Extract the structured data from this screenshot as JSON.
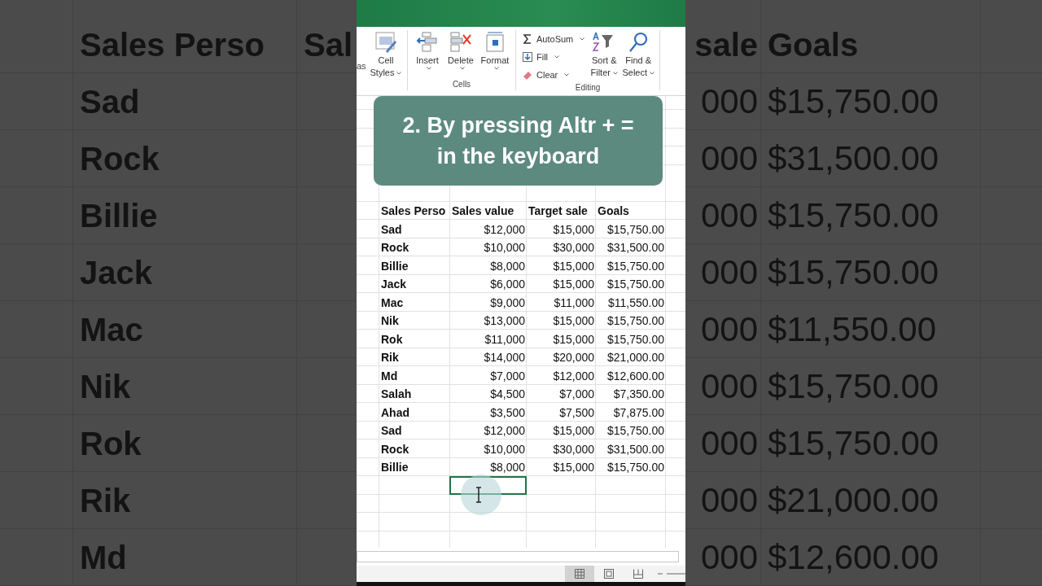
{
  "backdrop_left": {
    "headers": [
      "Sales Perso",
      "Sal"
    ],
    "names": [
      "Sad",
      "Rock",
      "Billie",
      "Jack",
      "Mac",
      "Nik",
      "Rok",
      "Rik",
      "Md"
    ]
  },
  "backdrop_right": {
    "headers": [
      "sale",
      "Goals"
    ],
    "rows": [
      {
        "target": "000",
        "goal": "$15,750.00"
      },
      {
        "target": "000",
        "goal": "$31,500.00"
      },
      {
        "target": "000",
        "goal": "$15,750.00"
      },
      {
        "target": "000",
        "goal": "$15,750.00"
      },
      {
        "target": "000",
        "goal": "$11,550.00"
      },
      {
        "target": "000",
        "goal": "$15,750.00"
      },
      {
        "target": "000",
        "goal": "$15,750.00"
      },
      {
        "target": "000",
        "goal": "$21,000.00"
      },
      {
        "target": "000",
        "goal": "$12,600.00"
      }
    ]
  },
  "ribbon": {
    "partial_label": "as",
    "groups": [
      {
        "items": [
          {
            "kind": "cell-styles",
            "lines": [
              "Cell",
              "Styles"
            ],
            "dropdown": true
          }
        ]
      },
      {
        "label": "Cells",
        "items": [
          {
            "kind": "insert",
            "lines": [
              "Insert"
            ],
            "dropdown": true
          },
          {
            "kind": "delete",
            "lines": [
              "Delete"
            ],
            "dropdown": true
          },
          {
            "kind": "format",
            "lines": [
              "Format"
            ],
            "dropdown": true
          }
        ]
      },
      {
        "label": "Editing",
        "items": [
          {
            "kind": "autosum",
            "lines": [
              "AutoSum"
            ],
            "dropdown": true
          },
          {
            "kind": "fill",
            "lines": [
              "Fill"
            ],
            "dropdown": true
          },
          {
            "kind": "clear",
            "lines": [
              "Clear"
            ],
            "dropdown": true
          },
          {
            "kind": "sort-filter",
            "lines": [
              "Sort &",
              "Filter"
            ],
            "dropdown": true
          },
          {
            "kind": "find-select",
            "lines": [
              "Find &",
              "Select"
            ],
            "dropdown": true
          }
        ]
      }
    ]
  },
  "caption": {
    "lines": [
      "2. By pressing Altr + =",
      "in the keyboard"
    ]
  },
  "sheet": {
    "rows": [
      {
        "header": true,
        "cells": [
          "Sales Perso",
          "Sales value",
          "Target sale",
          "Goals"
        ]
      },
      {
        "header": false,
        "cells": [
          "Sad",
          "$12,000",
          "$15,000",
          "$15,750.00"
        ]
      },
      {
        "header": false,
        "cells": [
          "Rock",
          "$10,000",
          "$30,000",
          "$31,500.00"
        ]
      },
      {
        "header": false,
        "cells": [
          "Billie",
          "$8,000",
          "$15,000",
          "$15,750.00"
        ]
      },
      {
        "header": false,
        "cells": [
          "Jack",
          "$6,000",
          "$15,000",
          "$15,750.00"
        ]
      },
      {
        "header": false,
        "cells": [
          "Mac",
          "$9,000",
          "$11,000",
          "$11,550.00"
        ]
      },
      {
        "header": false,
        "cells": [
          "Nik",
          "$13,000",
          "$15,000",
          "$15,750.00"
        ]
      },
      {
        "header": false,
        "cells": [
          "Rok",
          "$11,000",
          "$15,000",
          "$15,750.00"
        ]
      },
      {
        "header": false,
        "cells": [
          "Rik",
          "$14,000",
          "$20,000",
          "$21,000.00"
        ]
      },
      {
        "header": false,
        "cells": [
          "Md",
          "$7,000",
          "$12,000",
          "$12,600.00"
        ]
      },
      {
        "header": false,
        "cells": [
          "Salah",
          "$4,500",
          "$7,000",
          "$7,350.00"
        ]
      },
      {
        "header": false,
        "cells": [
          "Ahad",
          "$3,500",
          "$7,500",
          "$7,875.00"
        ]
      },
      {
        "header": false,
        "cells": [
          "Sad",
          "$12,000",
          "$15,000",
          "$15,750.00"
        ]
      },
      {
        "header": false,
        "cells": [
          "Rock",
          "$10,000",
          "$30,000",
          "$31,500.00"
        ]
      },
      {
        "header": false,
        "cells": [
          "Billie",
          "$8,000",
          "$15,000",
          "$15,750.00"
        ]
      }
    ],
    "blank_rows": [
      {
        "selected_cells": [
          false,
          true,
          false,
          false
        ]
      },
      {
        "selected_cells": [
          false,
          false,
          false,
          false
        ]
      },
      {
        "selected_cells": [
          false,
          false,
          false,
          false
        ]
      },
      {
        "selected_cells": [
          false,
          false,
          false,
          false
        ]
      }
    ]
  },
  "status_bar": {
    "views": [
      {
        "kind": "normal",
        "selected": true
      },
      {
        "kind": "page-layout",
        "selected": false
      },
      {
        "kind": "page-break",
        "selected": false
      }
    ]
  }
}
